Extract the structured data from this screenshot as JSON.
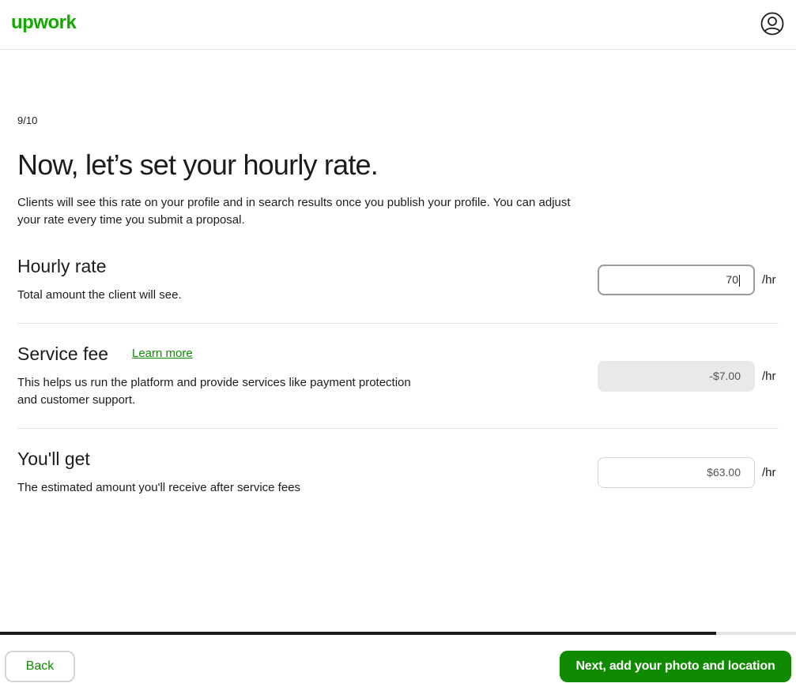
{
  "header": {
    "logo_text": "upwork",
    "avatar_icon": "user-circle-icon",
    "brand_color": "#14a800"
  },
  "step": "9/10",
  "title": "Now, let’s set your hourly rate.",
  "intro": "Clients will see this rate on your profile and in search results once you publish your profile. You can adjust your rate every time you submit a proposal.",
  "hourly_rate": {
    "title": "Hourly rate",
    "description": "Total amount the client will see.",
    "value": "70",
    "unit": "/hr"
  },
  "service_fee": {
    "title": "Service fee",
    "learn_more": "Learn more",
    "description_line1": "This helps us run the platform and provide services like payment protection",
    "description_line2": "and customer support.",
    "value": "-$7.00",
    "unit": "/hr"
  },
  "you_get": {
    "title": "You'll get",
    "description": "The estimated amount you'll receive after service fees",
    "value": "$63.00",
    "unit": "/hr"
  },
  "progress": {
    "fraction": 0.9
  },
  "footer": {
    "back_label": "Back",
    "next_label": "Next, add your photo and location",
    "accent_color": "#108a00"
  }
}
